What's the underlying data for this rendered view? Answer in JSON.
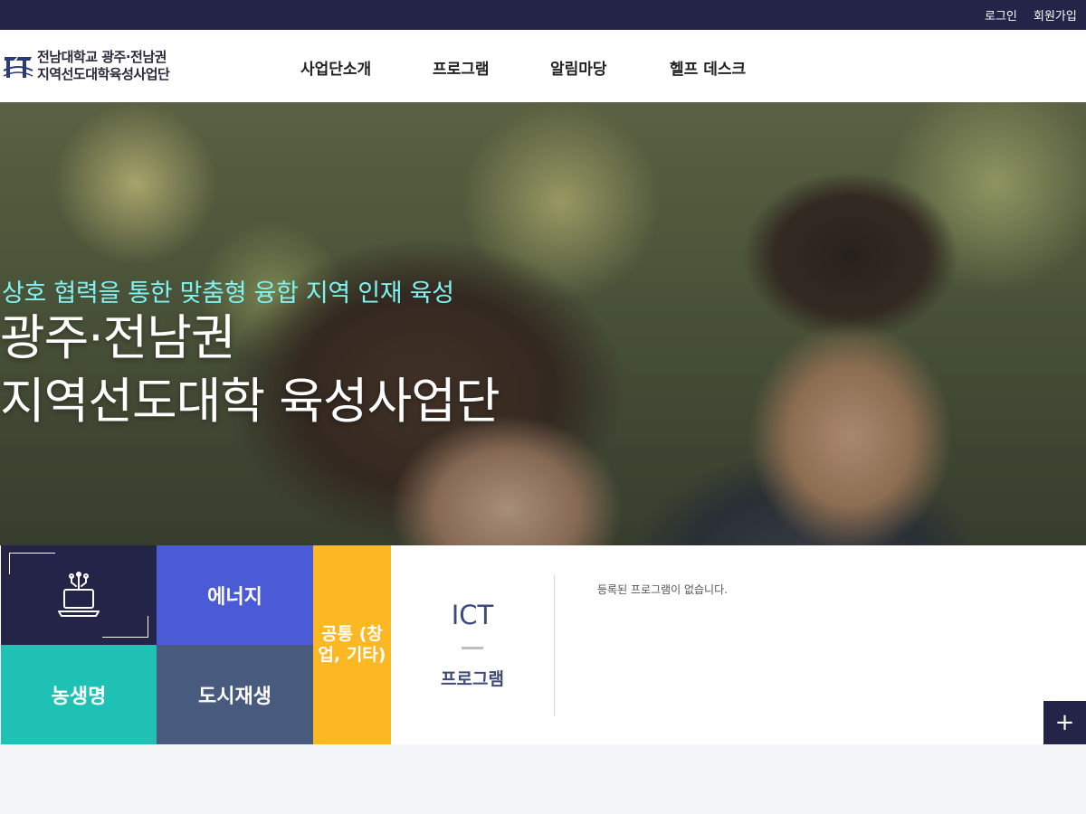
{
  "topbar": {
    "login": "로그인",
    "join": "회원가입"
  },
  "header": {
    "logo_line1": "전남대학교 광주·전남권",
    "logo_line2": "지역선도대학육성사업단",
    "logo_icon": "university-emblem-icon",
    "nav": [
      "사업단소개",
      "프로그램",
      "알림마당",
      "헬프 데스크"
    ]
  },
  "hero": {
    "subtitle": "상호 협력을 통한 맞춤형 융합 지역 인재 육성",
    "title_line1": "광주·전남권",
    "title_line2": "지역선도대학 육성사업단"
  },
  "tiles": {
    "icon": "laptop-network-icon",
    "energy": "에너지",
    "bio": "농생명",
    "urban": "도시재생",
    "common": "공통 (창업, 기타)",
    "ict_title": "ICT",
    "ict_program": "프로그램",
    "empty_message": "등록된 프로그램이 없습니다.",
    "more_icon": "plus-icon"
  },
  "colors": {
    "navy": "#232448",
    "energy": "#4b5bd6",
    "bio": "#1fc1b5",
    "urban": "#485a7d",
    "common": "#fbb823",
    "subtitle_cyan": "#7ff3f0"
  }
}
